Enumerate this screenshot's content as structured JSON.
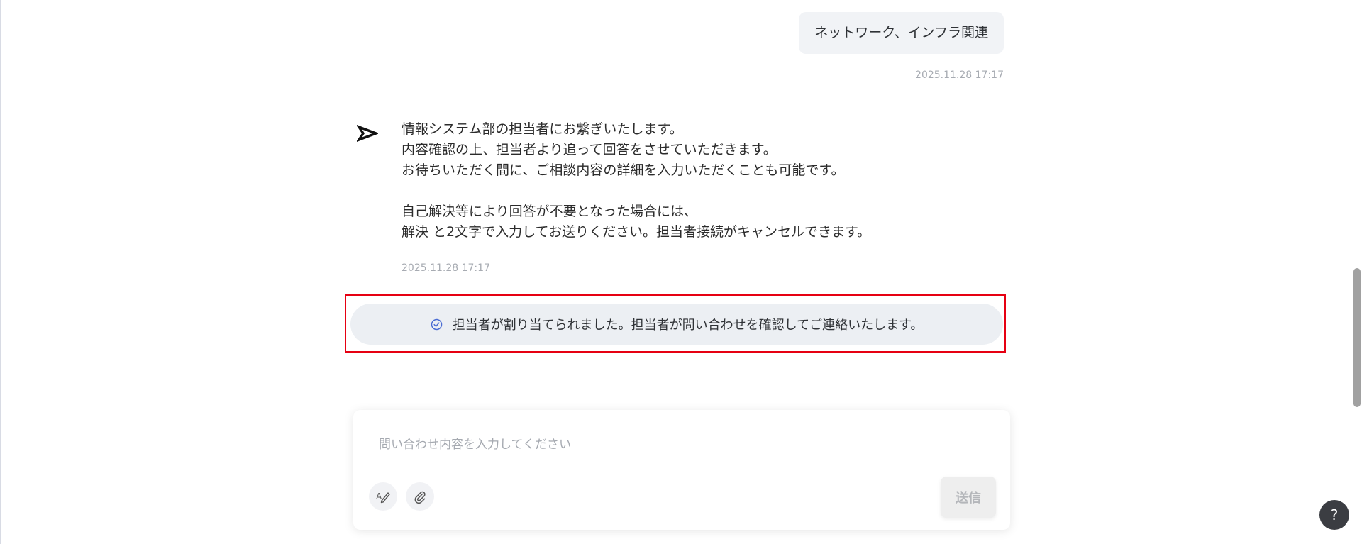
{
  "conversation": {
    "user_message": {
      "text": "ネットワーク、インフラ関連",
      "timestamp": "2025.11.28 17:17"
    },
    "bot_message": {
      "lines": "情報システム部の担当者にお繋ぎいたします。\n内容確認の上、担当者より追って回答をさせていただきます。\nお待ちいただく間に、ご相談内容の詳細を入力いただくことも可能です。\n\n自己解決等により回答が不要となった場合には、\n解決 と2文字で入力してお送りください。担当者接続がキャンセルできます。",
      "timestamp": "2025.11.28 17:17",
      "icon": "send-arrow-icon"
    },
    "system_notice": {
      "text": "担当者が割り当てられました。担当者が問い合わせを確認してご連絡いたします。",
      "icon": "check-circle-icon"
    }
  },
  "composer": {
    "placeholder": "問い合わせ内容を入力してください",
    "value": "",
    "send_label": "送信",
    "tools": [
      "ai-assist-icon",
      "paperclip-icon"
    ]
  },
  "help": {
    "label": "?"
  },
  "colors": {
    "highlight_border": "#e60012",
    "notice_bg": "#eceff3",
    "check_icon": "#4a6cd4",
    "help_bg": "#3b3d42"
  }
}
